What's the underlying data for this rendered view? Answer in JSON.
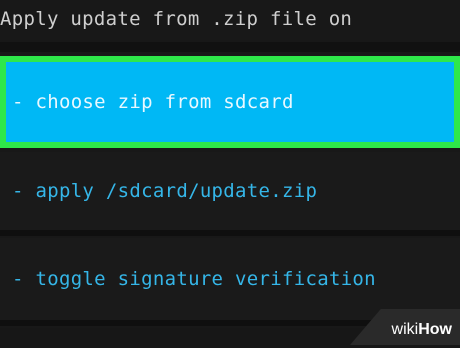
{
  "header": {
    "title": "Apply update from .zip file on"
  },
  "menu": {
    "items": [
      {
        "label": "- choose zip from sdcard",
        "selected": true
      },
      {
        "label": "- apply /sdcard/update.zip",
        "selected": false
      },
      {
        "label": "- toggle signature verification",
        "selected": false
      }
    ]
  },
  "watermark": {
    "wiki": "wiki",
    "how": "How"
  },
  "colors": {
    "background": "#181818",
    "highlight": "#00b8f5",
    "highlight_border": "#2ee84a",
    "menu_text": "#35b6e8",
    "header_text": "#cfcfcf"
  }
}
